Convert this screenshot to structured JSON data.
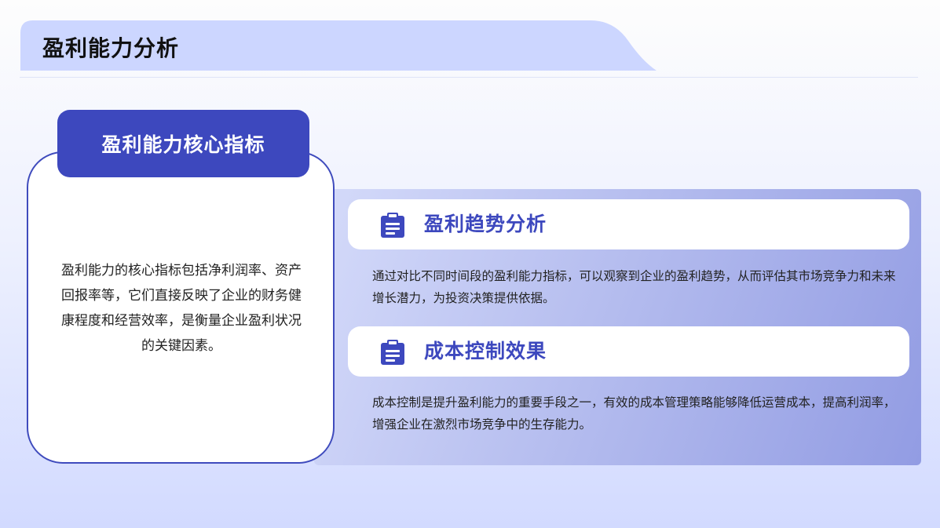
{
  "header": {
    "title": "盈利能力分析"
  },
  "core_metrics": {
    "tab_label": "盈利能力核心指标",
    "description": "盈利能力的核心指标包括净利润率、资产回报率等，它们直接反映了企业的财务健康程度和经营效率，是衡量企业盈利状况的关键因素。"
  },
  "sections": [
    {
      "icon": "clipboard-icon",
      "title": "盈利趋势分析",
      "body": "通过对比不同时间段的盈利能力指标，可以观察到企业的盈利趋势，从而评估其市场竞争力和未来增长潜力，为投资决策提供依据。"
    },
    {
      "icon": "clipboard-icon",
      "title": "成本控制效果",
      "body": "成本控制是提升盈利能力的重要手段之一，有效的成本管理策略能够降低运营成本，提高利润率，增强企业在激烈市场竞争中的生存能力。"
    }
  ],
  "colors": {
    "accent": "#3d48be",
    "title_bar": "#ccd6ff",
    "panel_start": "#d5dbfa",
    "panel_end": "#929ce3"
  }
}
